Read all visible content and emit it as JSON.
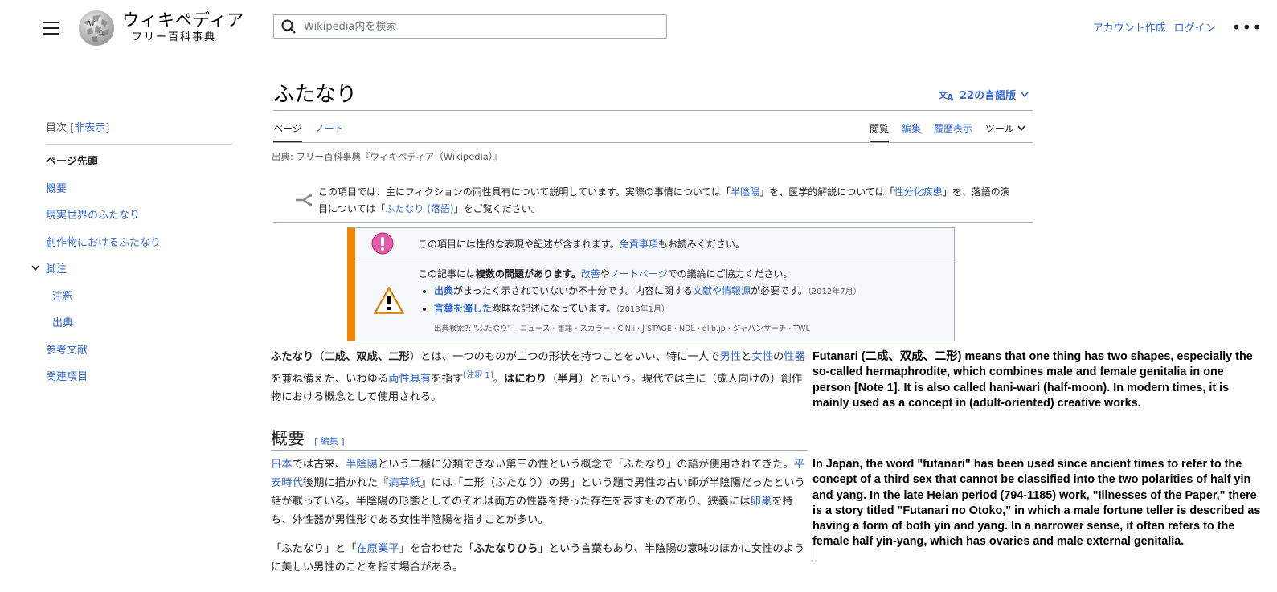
{
  "header": {
    "logo_line1": "ウィキペディア",
    "logo_line2": "フリー百科事典",
    "search_placeholder": "Wikipedia内を検索",
    "create_account": "アカウント作成",
    "login": "ログイン",
    "more": "•••"
  },
  "toc": {
    "heading": "目次 [",
    "hide": "非表示",
    "heading_end": "]",
    "items": [
      {
        "label": "ページ先頭"
      },
      {
        "label": "概要"
      },
      {
        "label": "現実世界のふたなり"
      },
      {
        "label": "創作物におけるふたなり"
      },
      {
        "label": "脚注"
      },
      {
        "label": "注釈"
      },
      {
        "label": "出典"
      },
      {
        "label": "参考文献"
      },
      {
        "label": "関連項目"
      }
    ]
  },
  "article": {
    "title": "ふたなり",
    "languages": "22の言語版",
    "tabs_left": [
      "ページ",
      "ノート"
    ],
    "tabs_right": [
      "閲覧",
      "編集",
      "履歴表示",
      "ツール"
    ],
    "source": "出典: フリー百科事典『ウィキペディア（Wikipedia）』",
    "hatnote": {
      "t1": "この項目では、主にフィクションの両性具有について説明しています。実際の事情については「",
      "l1": "半陰陽",
      "t2": "」を、医学的解説については「",
      "l2": "性分化疾患",
      "t3": "」を、落語の演目については「",
      "l3": "ふたなり (落語)",
      "t4": "」をご覧ください。"
    },
    "ambox": {
      "row1_a": "この項目には性的な表現や記述が含まれます。",
      "row1_link": "免責事項",
      "row1_b": "もお読みください。",
      "row2_a": "この記事には",
      "row2_bold": "複数の問題があります。",
      "row2_link1": "改善",
      "row2_mid": "や",
      "row2_link2": "ノートページ",
      "row2_b": "での議論にご協力ください。",
      "b1_link": "出典",
      "b1_text": "がまったく示されていないか不十分です。内容に関する",
      "b1_link2": "文献や情報源",
      "b1_text2": "が必要です。",
      "b1_date": "（2012年7月）",
      "b2_link": "言葉を濁した",
      "b2_text": "曖昧な記述になっています。",
      "b2_date": "（2013年1月）",
      "search_line": "出典検索?: \"ふたなり\" – ニュース · 書籍 · スカラー · CiNii · J-STAGE · NDL · dlib.jp · ジャパンサーチ · TWL"
    },
    "lead": {
      "bold1": "ふたなり",
      "p1": "（",
      "bold2": "二成、双成、二形",
      "p2": "）とは、一つのものが二つの形状を持つことをいい、特に一人で",
      "l1": "男性",
      "p3": "と",
      "l2": "女性",
      "p4": "の",
      "l3": "性器",
      "p5": "を兼ね備えた、いわゆる",
      "l4": "両性具有",
      "p6": "を指す",
      "note": "[注釈 1]",
      "p7": "。",
      "bold3": "はにわり",
      "p8": "（",
      "bold4": "半月",
      "p9": "）ともいう。現代では主に（成人向けの）創作物における概念として使用される。"
    },
    "section1": {
      "heading": "概要",
      "edit": "[ 編集 ]",
      "para1": {
        "l1": "日本",
        "t1": "では古来、",
        "l2": "半陰陽",
        "t2": "という二極に分類できない第三の性という概念で「ふたなり」の語が使用されてきた。",
        "l3": "平安時代",
        "t3": "後期に描かれた『",
        "l4": "病草紙",
        "t4": "』には「二形（ふたなり）の男」という題で男性の占い師が半陰陽だったという話が載っている。半陰陽の形態としてのそれは両方の性器を持った存在を表すものであり、狭義には",
        "l5": "卵巣",
        "t5": "を持ち、外性器が男性形である女性半陰陽を指すことが多い。"
      },
      "para2": {
        "t1": "「ふたなり」と「",
        "l1": "在原業平",
        "t2": "」を合わせた「",
        "bold": "ふたなりひら",
        "t3": "」という言葉もあり、半陰陽の意味のほかに女性のように美しい男性のことを指す場合がある。"
      }
    }
  },
  "translation": {
    "p1": "Futanari (二成、双成、二形) means that one thing has two shapes, especially the so-called hermaphrodite, which combines male and female genitalia in one person [Note 1]. It is also called hani-wari (half-moon). In modern times, it is mainly used as a concept in (adult-oriented) creative works.",
    "p2": "In Japan, the word \"futanari\" has been used since ancient times to refer to the concept of a third sex that cannot be classified into the two polarities of half yin and yang. In the late Heian period (794-1185) work, \"Illnesses of the Paper,\" there is a story titled \"Futanari no Otoko,\" in which a male fortune teller is described as having a form of both yin and yang. In a narrower sense, it often refers to the female half yin-yang, which has ovaries and male external genitalia."
  },
  "colors": {
    "link": "#3366cc",
    "warning": "#f28500",
    "notice": "#d33"
  }
}
